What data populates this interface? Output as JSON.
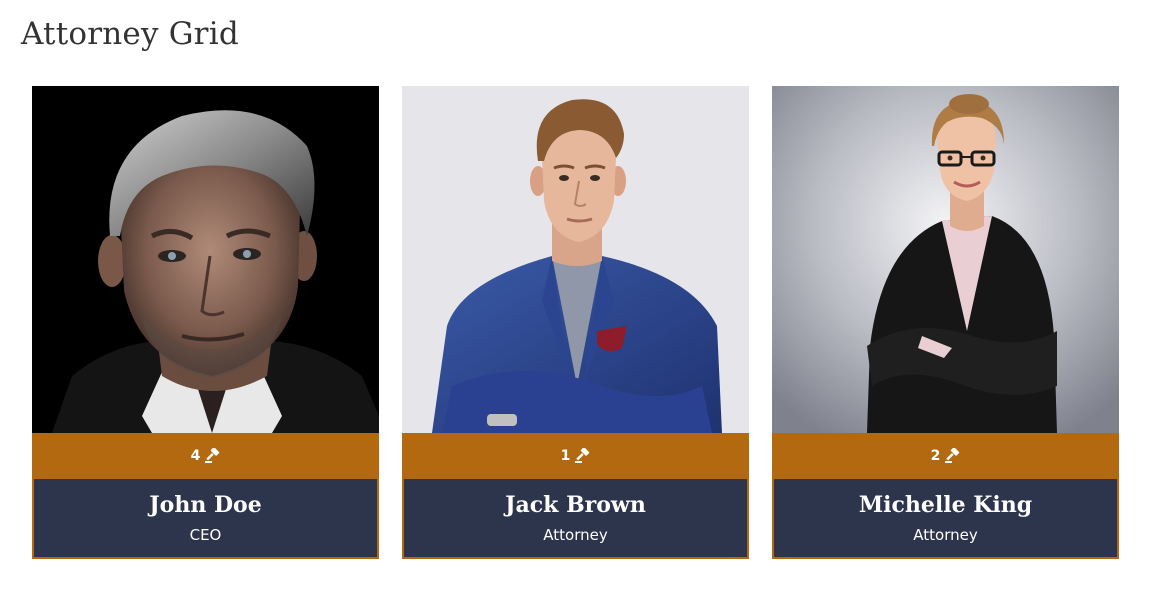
{
  "page": {
    "title": "Attorney Grid"
  },
  "colors": {
    "accent": "#b3690f",
    "card_info_bg": "#2d354c",
    "title_text": "#333333"
  },
  "attorneys": [
    {
      "name": "John Doe",
      "role": "CEO",
      "cases": "4",
      "icon": "gavel-icon",
      "photo": "portrait-photo"
    },
    {
      "name": "Jack Brown",
      "role": "Attorney",
      "cases": "1",
      "icon": "gavel-icon",
      "photo": "portrait-photo"
    },
    {
      "name": "Michelle King",
      "role": "Attorney",
      "cases": "2",
      "icon": "gavel-icon",
      "photo": "portrait-photo"
    }
  ]
}
